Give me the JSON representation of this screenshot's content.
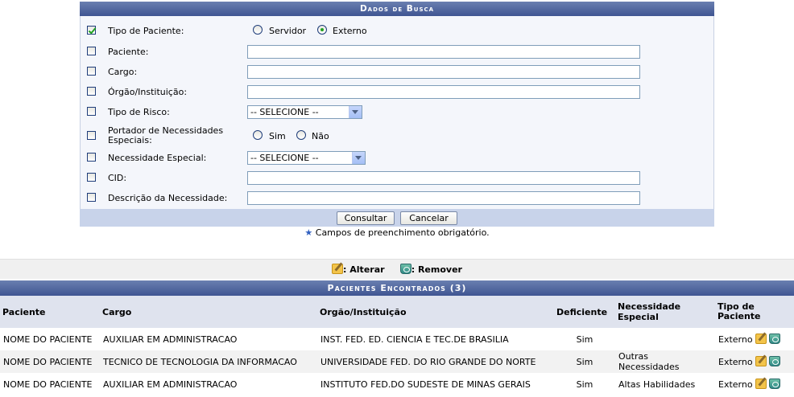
{
  "search_form": {
    "caption": "Dados de Busca",
    "rows": {
      "tipo_paciente": {
        "label": "Tipo de Paciente:",
        "checked": true,
        "options": [
          "Servidor",
          "Externo"
        ],
        "selected": "Externo"
      },
      "paciente": {
        "label": "Paciente:",
        "checked": false,
        "value": ""
      },
      "cargo": {
        "label": "Cargo:",
        "checked": false,
        "value": ""
      },
      "orgao": {
        "label": "Órgão/Instituição:",
        "checked": false,
        "value": ""
      },
      "tipo_risco": {
        "label": "Tipo de Risco:",
        "checked": false,
        "selected": "-- SELECIONE --"
      },
      "portador": {
        "label": "Portador de Necessidades Especiais:",
        "checked": false,
        "options": [
          "Sim",
          "Não"
        ],
        "selected": ""
      },
      "necessidade": {
        "label": "Necessidade Especial:",
        "checked": false,
        "selected": "-- SELECIONE --"
      },
      "cid": {
        "label": "CID:",
        "checked": false,
        "value": ""
      },
      "descricao": {
        "label": "Descrição da Necessidade:",
        "checked": false,
        "value": ""
      }
    },
    "buttons": {
      "consultar": "Consultar",
      "cancelar": "Cancelar"
    },
    "required_note": "Campos de preenchimento obrigatório."
  },
  "legend": {
    "alterar": ": Alterar",
    "remover": ": Remover"
  },
  "results": {
    "caption": "Pacientes Encontrados (3)",
    "columns": [
      "Paciente",
      "Cargo",
      "Orgão/Instituição",
      "Deficiente",
      "Necessidade Especial",
      "Tipo de Paciente"
    ],
    "rows": [
      {
        "paciente": "NOME DO PACIENTE",
        "cargo": "AUXILIAR EM ADMINISTRACAO",
        "orgao": "INST. FED. ED. CIENCIA E TEC.DE BRASILIA",
        "deficiente": "Sim",
        "necessidade": "",
        "tipo": "Externo"
      },
      {
        "paciente": "NOME DO PACIENTE",
        "cargo": "TECNICO DE TECNOLOGIA DA INFORMACAO",
        "orgao": "UNIVERSIDADE FED. DO RIO GRANDE DO NORTE",
        "deficiente": "Sim",
        "necessidade": "Outras Necessidades",
        "tipo": "Externo"
      },
      {
        "paciente": "NOME DO PACIENTE",
        "cargo": "AUXILIAR EM ADMINISTRACAO",
        "orgao": "INSTITUTO FED.DO SUDESTE DE MINAS GERAIS",
        "deficiente": "Sim",
        "necessidade": "Altas Habilidades",
        "tipo": "Externo"
      }
    ]
  },
  "icons": {
    "edit": "edit-pencil-icon",
    "remove": "trash-icon",
    "required": "star-icon"
  }
}
